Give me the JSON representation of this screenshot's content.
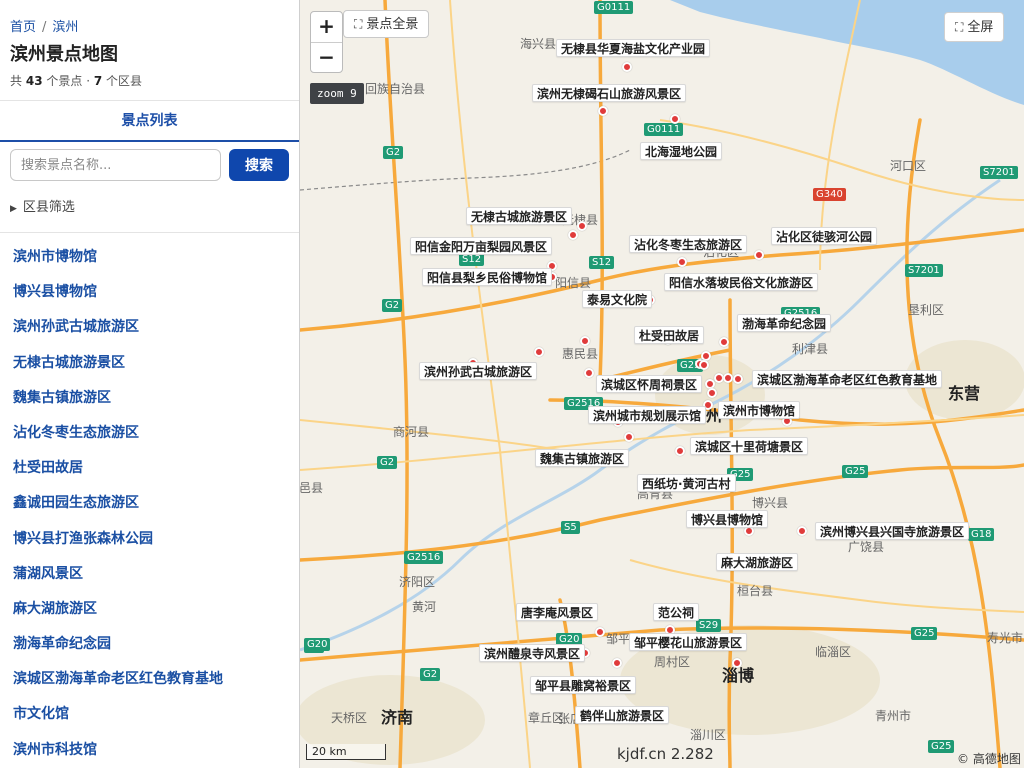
{
  "breadcrumb": {
    "home": "首页",
    "separator": "/",
    "current": "滨州"
  },
  "page_title": "滨州景点地图",
  "meta": {
    "prefix": "共",
    "spot_count": "43",
    "spot_unit": "个景点 ·",
    "district_count": "7",
    "district_unit": "个区县"
  },
  "tab_label": "景点列表",
  "search": {
    "placeholder": "搜索景点名称...",
    "button": "搜索"
  },
  "filter_label": "区县筛选",
  "spots": [
    "滨州市博物馆",
    "博兴县博物馆",
    "滨州孙武古城旅游区",
    "无棣古城旅游景区",
    "魏集古镇旅游区",
    "沾化冬枣生态旅游区",
    "杜受田故居",
    "鑫诚田园生态旅游区",
    "博兴县打渔张森林公园",
    "蒲湖风景区",
    "麻大湖旅游区",
    "渤海革命纪念园",
    "滨城区渤海革命老区红色教育基地",
    "市文化馆",
    "滨州市科技馆"
  ],
  "map": {
    "overview_button": "景点全景",
    "fullscreen_button": "全屏",
    "zoom_in": "+",
    "zoom_out": "−",
    "zoom_badge": "zoom 9",
    "scale_label": "20 km",
    "source_text": "kjdf.cn 2.282",
    "attribution": "© 高德地图",
    "icons": {
      "overview": "expand-icon",
      "fullscreen": "expand-icon"
    },
    "colors": {
      "water": "#a8cdec",
      "expressway": "#f7a93c",
      "poi_marker": "#e03b3b",
      "city_area": "#ece6d3"
    },
    "place_names": [
      {
        "name": "海兴县",
        "size": "small"
      },
      {
        "name": "回族自治县",
        "size": "small"
      },
      {
        "name": "无棣县",
        "size": "small"
      },
      {
        "name": "阳信县",
        "size": "small"
      },
      {
        "name": "惠民县",
        "size": "small"
      },
      {
        "name": "沾化区",
        "size": "small"
      },
      {
        "name": "河口区",
        "size": "small"
      },
      {
        "name": "垦利区",
        "size": "small"
      },
      {
        "name": "利津县",
        "size": "small"
      },
      {
        "name": "东营",
        "size": "large"
      },
      {
        "name": "滨州",
        "size": "large"
      },
      {
        "name": "商河县",
        "size": "small"
      },
      {
        "name": "邑县",
        "size": "small"
      },
      {
        "name": "高青县",
        "size": "small"
      },
      {
        "name": "博兴县",
        "size": "small"
      },
      {
        "name": "广饶县",
        "size": "small"
      },
      {
        "name": "济阳区",
        "size": "small"
      },
      {
        "name": "桓台县",
        "size": "small"
      },
      {
        "name": "邹平",
        "size": "small"
      },
      {
        "name": "周村区",
        "size": "small"
      },
      {
        "name": "临淄区",
        "size": "small"
      },
      {
        "name": "淄博",
        "size": "large"
      },
      {
        "name": "张店区",
        "size": "small"
      },
      {
        "name": "章丘区",
        "size": "small"
      },
      {
        "name": "济南",
        "size": "large"
      },
      {
        "name": "天桥区",
        "size": "small"
      },
      {
        "name": "淄川区",
        "size": "small"
      },
      {
        "name": "青州市",
        "size": "small"
      },
      {
        "name": "寿光市",
        "size": "small"
      },
      {
        "name": "黄河",
        "size": "small"
      }
    ],
    "road_labels": [
      "G0111",
      "G0111",
      "G2",
      "G2",
      "G2",
      "G2",
      "G2",
      "S12",
      "S12",
      "G340",
      "S7201",
      "S7201",
      "G2516",
      "G2516",
      "G2516",
      "G25",
      "G25",
      "G25",
      "G25",
      "G25",
      "S5",
      "S29",
      "G20",
      "G20",
      "G18"
    ],
    "pois": [
      "无棣县华夏海盐文化产业园",
      "滨州无棣碣石山旅游风景区",
      "北海湿地公园",
      "无棣古城旅游景区",
      "阳信金阳万亩梨园风景区",
      "阳信县梨乡民俗博物馆",
      "沾化冬枣生态旅游区",
      "沾化区徒骇河公园",
      "阳信水落坡民俗文化旅游区",
      "泰易文化院",
      "杜受田故居",
      "渤海革命纪念园",
      "滨州孙武古城旅游区",
      "滨城区怀周祠景区",
      "滨城区渤海革命老区红色教育基地",
      "滨州城市规划展示馆",
      "滨州市博物馆",
      "滨城区十里荷塘景区",
      "魏集古镇旅游区",
      "西纸坊·黄河古村",
      "博兴县博物馆",
      "滨州博兴县兴国寺旅游景区",
      "麻大湖旅游区",
      "唐李庵风景区",
      "范公祠",
      "滨州醴泉寺风景区",
      "邹平樱花山旅游景区",
      "邹平县雕窝裕景区",
      "鹤伴山旅游景区"
    ]
  }
}
